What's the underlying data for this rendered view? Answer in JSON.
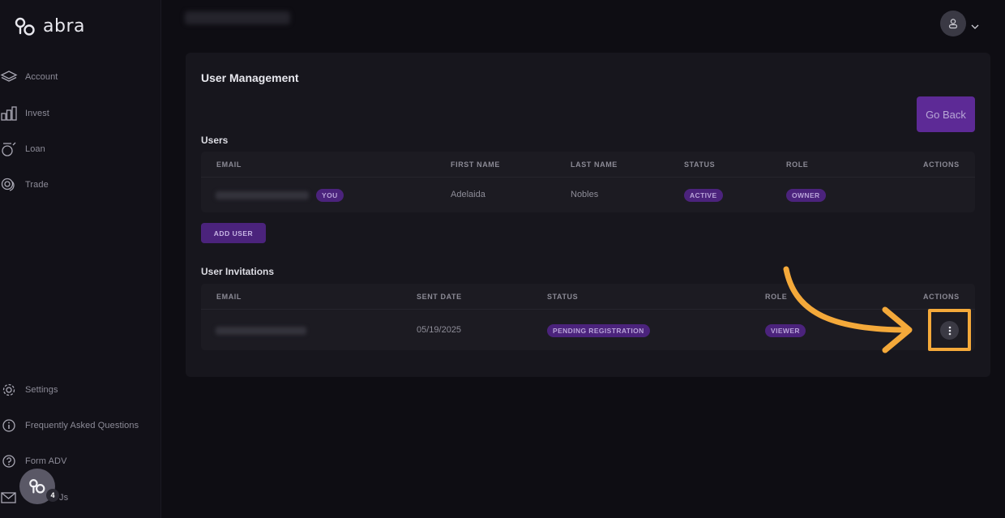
{
  "app": {
    "brand": "abra"
  },
  "sidebar": {
    "items": [
      {
        "label": "Account",
        "icon": "layers-icon"
      },
      {
        "label": "Invest",
        "icon": "bar-chart-icon"
      },
      {
        "label": "Loan",
        "icon": "loan-icon"
      },
      {
        "label": "Trade",
        "icon": "coins-icon"
      }
    ],
    "footer_items": [
      {
        "label": "Settings",
        "icon": "gear-icon"
      },
      {
        "label": "Frequently Asked Questions",
        "icon": "info-icon"
      },
      {
        "label": "Form ADV",
        "icon": "help-icon"
      },
      {
        "label": "Js",
        "icon": "mail-icon"
      }
    ],
    "chat_badge": "4"
  },
  "main": {
    "title": "User Management",
    "go_back_label": "Go Back",
    "users_section": {
      "title": "Users",
      "columns": [
        "EMAIL",
        "FIRST NAME",
        "LAST NAME",
        "STATUS",
        "ROLE",
        "ACTIONS"
      ],
      "rows": [
        {
          "you_badge": "YOU",
          "first_name": "Adelaida",
          "last_name": "Nobles",
          "status": "ACTIVE",
          "role": "OWNER"
        }
      ],
      "add_user_label": "ADD USER"
    },
    "invitations_section": {
      "title": "User Invitations",
      "columns": [
        "EMAIL",
        "SENT DATE",
        "STATUS",
        "ROLE",
        "ACTIONS"
      ],
      "rows": [
        {
          "sent_date": "05/19/2025",
          "status": "PENDING REGISTRATION",
          "role": "VIEWER"
        }
      ]
    }
  },
  "colors": {
    "background": "#0e0d13",
    "accent": "#5d2a96",
    "pill": "#4b237c",
    "highlight": "#f4a93a"
  }
}
